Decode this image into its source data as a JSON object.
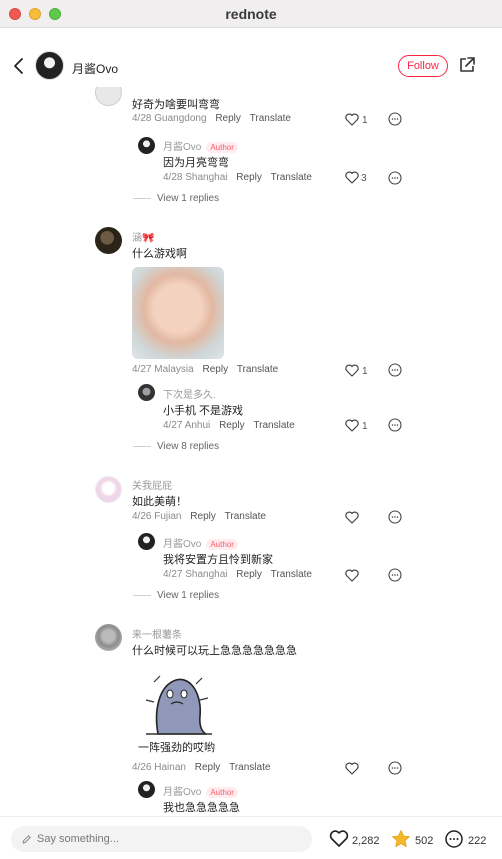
{
  "window": {
    "title": "rednote"
  },
  "header": {
    "author_name": "月酱Ovo",
    "follow_label": "Follow"
  },
  "labels": {
    "reply": "Reply",
    "translate": "Translate",
    "author": "Author"
  },
  "comments": [
    {
      "name": "",
      "text": "好奇为啥要叫弯弯",
      "date": "4/28",
      "location": "Guangdong",
      "likes": "1",
      "replies": [
        {
          "name": "月酱Ovo",
          "text": "因为月亮弯弯",
          "date": "4/28",
          "location": "Shanghai",
          "likes": "3",
          "is_author": true
        }
      ],
      "view_replies": "View 1 replies"
    },
    {
      "name": "涵🎀",
      "text": "什么游戏啊",
      "date": "4/27",
      "location": "Malaysia",
      "likes": "1",
      "replies": [
        {
          "name": "下次是多久.",
          "text": "小手机 不是游戏",
          "date": "4/27",
          "location": "Anhui",
          "likes": "1",
          "is_author": false
        }
      ],
      "view_replies": "View 8 replies"
    },
    {
      "name": "关我屁屁",
      "text": "如此美萌！",
      "date": "4/26",
      "location": "Fujian",
      "likes": "",
      "replies": [
        {
          "name": "月酱Ovo",
          "text": "我将安置方且怜到新家",
          "date": "4/27",
          "location": "Shanghai",
          "likes": "",
          "is_author": true
        }
      ],
      "view_replies": "View 1 replies"
    },
    {
      "name": "来一根薯条",
      "text": "什么时候可以玩上急急急急急急急",
      "date": "4/26",
      "location": "Hainan",
      "likes": "",
      "sticker_caption": "一阵强劲的哎哟",
      "replies": [
        {
          "name": "月酱Ovo",
          "text": "我也急急急急急",
          "date": "",
          "location": "",
          "likes": "",
          "is_author": true
        }
      ]
    }
  ],
  "bottom": {
    "placeholder": "Say something...",
    "likes": "2,282",
    "collects": "502",
    "comments": "222"
  },
  "colors": {
    "accent": "#ff2442",
    "star": "#f5b82a"
  }
}
